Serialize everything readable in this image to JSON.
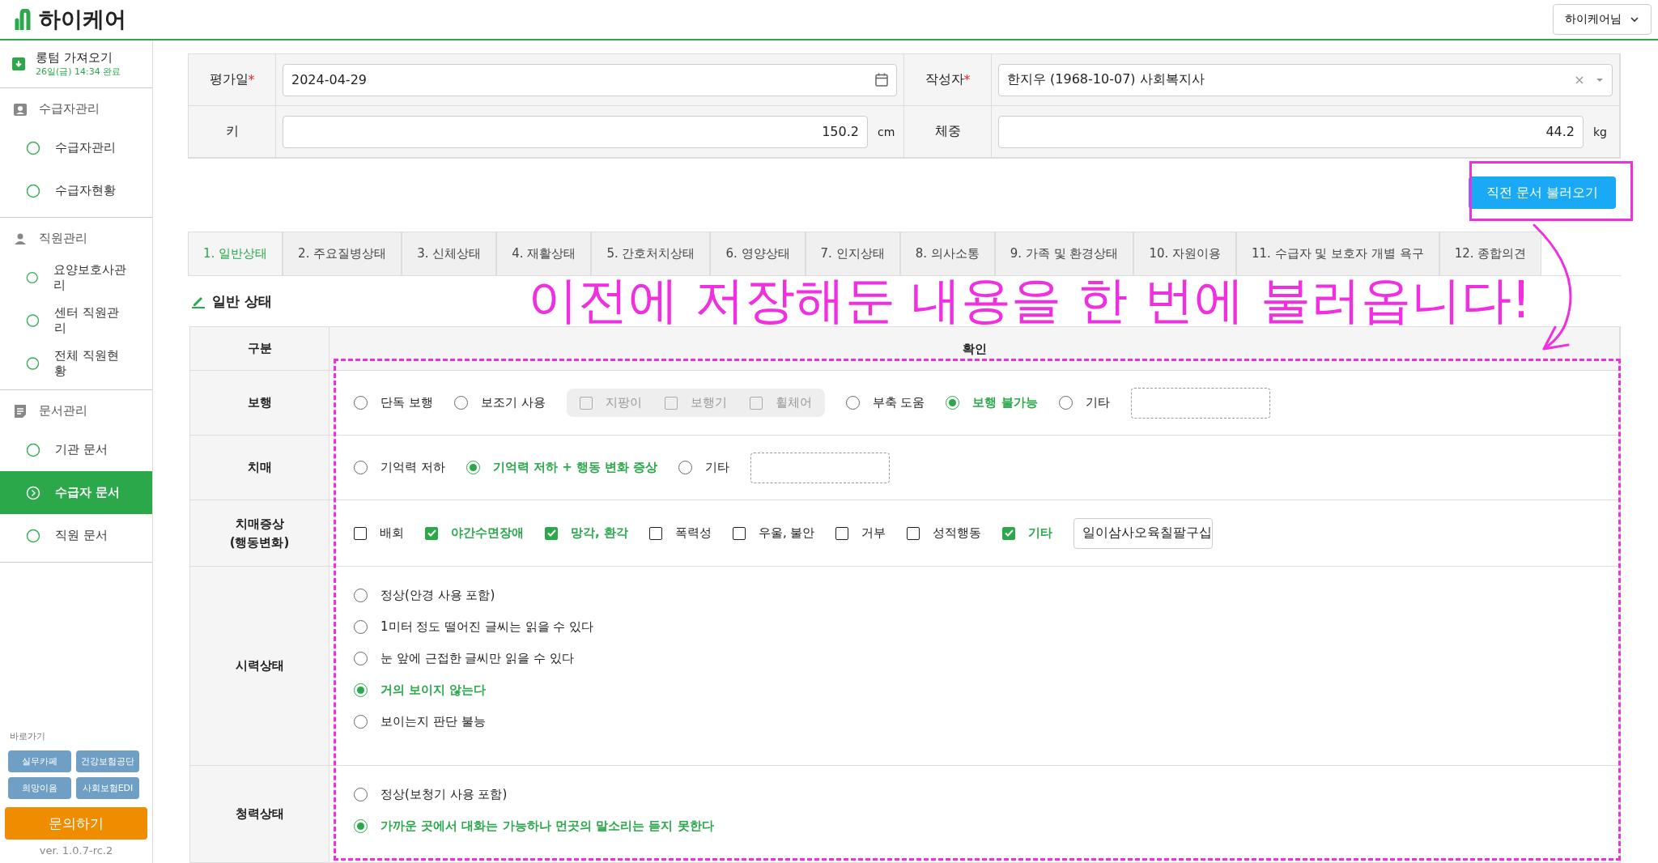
{
  "header": {
    "logo": "하이케어",
    "user_menu": "하이케어님"
  },
  "sidebar": {
    "sync": {
      "title": "롱텀 가져오기",
      "status": "26일(금) 14:34 완료"
    },
    "groups": [
      {
        "title": "수급자관리",
        "items": [
          {
            "label": "수급자관리",
            "selected": false
          },
          {
            "label": "수급자현황",
            "selected": false
          }
        ]
      },
      {
        "title": "직원관리",
        "items": [
          {
            "label": "요양보호사관리",
            "selected": false
          },
          {
            "label": "센터 직원관리",
            "selected": false
          },
          {
            "label": "전체 직원현황",
            "selected": false
          }
        ]
      },
      {
        "title": "문서관리",
        "items": [
          {
            "label": "기관 문서",
            "selected": false
          },
          {
            "label": "수급자 문서",
            "selected": true
          },
          {
            "label": "직원 문서",
            "selected": false
          }
        ]
      }
    ],
    "shortcuts_title": "바로가기",
    "shortcuts": [
      "실무카페",
      "건강보험공단",
      "희망이음",
      "사회보험EDI"
    ],
    "contact_button": "문의하기",
    "version": "ver. 1.0.7-rc.2"
  },
  "form": {
    "fields": [
      {
        "label": "평가일",
        "required_mark": "*",
        "value": "2024-04-29",
        "kind": "date"
      },
      {
        "label": "작성자",
        "required_mark": "*",
        "value": "한지우 (1968-10-07) 사회복지사",
        "kind": "select"
      },
      {
        "label": "키",
        "value": "150.2",
        "unit": "cm",
        "kind": "number"
      },
      {
        "label": "체중",
        "value": "44.2",
        "unit": "kg",
        "kind": "number"
      }
    ],
    "load_button": "직전 문서 불러오기"
  },
  "tabs": [
    {
      "label": "1. 일반상태",
      "selected": true
    },
    {
      "label": "2. 주요질병상태",
      "selected": false
    },
    {
      "label": "3. 신체상태",
      "selected": false
    },
    {
      "label": "4. 재활상태",
      "selected": false
    },
    {
      "label": "5. 간호처치상태",
      "selected": false
    },
    {
      "label": "6. 영양상태",
      "selected": false
    },
    {
      "label": "7. 인지상태",
      "selected": false
    },
    {
      "label": "8. 의사소통",
      "selected": false
    },
    {
      "label": "9. 가족 및 환경상태",
      "selected": false
    },
    {
      "label": "10. 자원이용",
      "selected": false
    },
    {
      "label": "11. 수급자 및 보호자 개별 욕구",
      "selected": false
    },
    {
      "label": "12. 종합의견",
      "selected": false
    }
  ],
  "section_title": "일반 상태",
  "table": {
    "columns": [
      "구분",
      "확인"
    ],
    "rows": [
      {
        "label": "보행",
        "kind": "inline",
        "options": [
          {
            "kind": "radio",
            "label": "단독 보행",
            "selected": false
          },
          {
            "kind": "radio",
            "label": "보조기 사용",
            "selected": false
          },
          {
            "kind": "group",
            "disabled": true,
            "options": [
              {
                "label": "지팡이",
                "checked": false
              },
              {
                "label": "보행기",
                "checked": false
              },
              {
                "label": "휠체어",
                "checked": false
              }
            ]
          },
          {
            "kind": "radio",
            "label": "부축 도움",
            "selected": false
          },
          {
            "kind": "radio",
            "label": "보행 불가능",
            "selected": true
          },
          {
            "kind": "radio",
            "label": "기타",
            "selected": false
          },
          {
            "kind": "field"
          }
        ]
      },
      {
        "label": "치매",
        "kind": "inline",
        "options": [
          {
            "kind": "radio",
            "label": "기억력 저하",
            "selected": false
          },
          {
            "kind": "radio",
            "label": "기억력 저하 + 행동 변화 증상",
            "selected": true
          },
          {
            "kind": "radio",
            "label": "기타",
            "selected": false
          },
          {
            "kind": "field"
          }
        ]
      },
      {
        "label": "치매증상\n(행동변화)",
        "kind": "inline",
        "options": [
          {
            "kind": "checkbox",
            "label": "배회",
            "checked": false
          },
          {
            "kind": "checkbox",
            "label": "야간수면장애",
            "checked": true
          },
          {
            "kind": "checkbox",
            "label": "망각, 환각",
            "checked": true
          },
          {
            "kind": "checkbox",
            "label": "폭력성",
            "checked": false
          },
          {
            "kind": "checkbox",
            "label": "우울, 불안",
            "checked": false
          },
          {
            "kind": "checkbox",
            "label": "거부",
            "checked": false
          },
          {
            "kind": "checkbox",
            "label": "성적행동",
            "checked": false
          },
          {
            "kind": "checkbox",
            "label": "기타",
            "checked": true
          },
          {
            "kind": "field",
            "value": "일이삼사오육칠팔구십"
          }
        ]
      },
      {
        "label": "시력상태",
        "kind": "stack",
        "options": [
          {
            "kind": "radio",
            "label": "정상(안경 사용 포함)",
            "selected": false
          },
          {
            "kind": "radio",
            "label": "1미터 정도 떨어진 글씨는 읽을 수 있다",
            "selected": false
          },
          {
            "kind": "radio",
            "label": "눈 앞에 근접한 글씨만 읽을 수 있다",
            "selected": false
          },
          {
            "kind": "radio",
            "label": "거의 보이지 않는다",
            "selected": true
          },
          {
            "kind": "radio",
            "label": "보이는지 판단 불능",
            "selected": false
          }
        ]
      },
      {
        "label": "청력상태",
        "kind": "stack",
        "options": [
          {
            "kind": "radio",
            "label": "정상(보청기 사용 포함)",
            "selected": false
          },
          {
            "kind": "radio",
            "label": "가까운 곳에서 대화는 가능하나 먼곳의 말소리는 듣지 못한다",
            "selected": true
          }
        ]
      }
    ]
  },
  "annotation": {
    "caption": "이전에 저장해둔 내용을 한 번에 불러옵니다!"
  }
}
